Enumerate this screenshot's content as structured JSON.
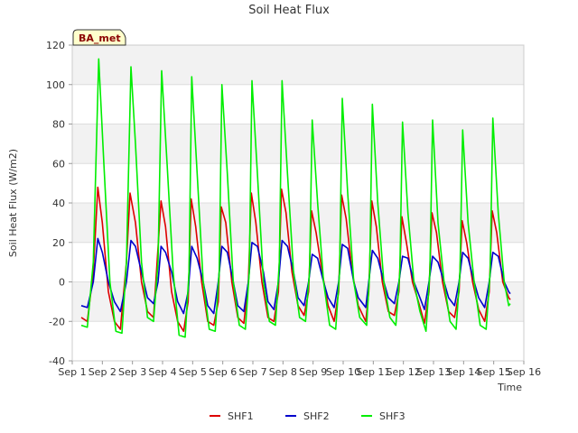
{
  "chart_data": {
    "type": "line",
    "title": "Soil Heat Flux",
    "xlabel": "Time",
    "ylabel": "Soil Heat Flux (W/m2)",
    "badge": "BA_met",
    "ylim": [
      -40,
      120
    ],
    "xlim": [
      1,
      16
    ],
    "y_ticks": [
      -40,
      -20,
      0,
      20,
      40,
      60,
      80,
      100,
      120
    ],
    "x_ticks": [
      {
        "x": 1,
        "label": "Sep 1"
      },
      {
        "x": 2,
        "label": "Sep 2"
      },
      {
        "x": 3,
        "label": "Sep 3"
      },
      {
        "x": 4,
        "label": "Sep 4"
      },
      {
        "x": 5,
        "label": "Sep 5"
      },
      {
        "x": 6,
        "label": "Sep 6"
      },
      {
        "x": 7,
        "label": "Sep 7"
      },
      {
        "x": 8,
        "label": "Sep 8"
      },
      {
        "x": 9,
        "label": "Sep 9"
      },
      {
        "x": 10,
        "label": "Sep 10"
      },
      {
        "x": 11,
        "label": "Sep 11"
      },
      {
        "x": 12,
        "label": "Sep 12"
      },
      {
        "x": 13,
        "label": "Sep 13"
      },
      {
        "x": 14,
        "label": "Sep 14"
      },
      {
        "x": 15,
        "label": "Sep 15"
      },
      {
        "x": 16,
        "label": "Sep 16"
      }
    ],
    "grid": "horizontal bands",
    "legend_position": "bottom-center",
    "series": [
      {
        "name": "SHF1",
        "color": "#dd0000",
        "points": [
          [
            1.3,
            -18
          ],
          [
            1.5,
            -20
          ],
          [
            1.7,
            5
          ],
          [
            1.85,
            48
          ],
          [
            2.0,
            30
          ],
          [
            2.2,
            -5
          ],
          [
            2.4,
            -20
          ],
          [
            2.6,
            -24
          ],
          [
            2.8,
            10
          ],
          [
            2.92,
            45
          ],
          [
            3.1,
            30
          ],
          [
            3.3,
            0
          ],
          [
            3.5,
            -15
          ],
          [
            3.7,
            -18
          ],
          [
            3.95,
            41
          ],
          [
            4.1,
            28
          ],
          [
            4.3,
            -5
          ],
          [
            4.5,
            -20
          ],
          [
            4.7,
            -25
          ],
          [
            4.85,
            -10
          ],
          [
            4.95,
            42
          ],
          [
            5.1,
            28
          ],
          [
            5.3,
            0
          ],
          [
            5.5,
            -20
          ],
          [
            5.7,
            -22
          ],
          [
            5.85,
            -10
          ],
          [
            5.95,
            38
          ],
          [
            6.1,
            30
          ],
          [
            6.3,
            0
          ],
          [
            6.5,
            -18
          ],
          [
            6.7,
            -21
          ],
          [
            6.85,
            0
          ],
          [
            6.95,
            45
          ],
          [
            7.1,
            30
          ],
          [
            7.3,
            0
          ],
          [
            7.5,
            -18
          ],
          [
            7.7,
            -20
          ],
          [
            7.85,
            -5
          ],
          [
            7.95,
            47
          ],
          [
            8.1,
            35
          ],
          [
            8.3,
            5
          ],
          [
            8.5,
            -12
          ],
          [
            8.7,
            -17
          ],
          [
            8.85,
            -5
          ],
          [
            8.95,
            36
          ],
          [
            9.1,
            25
          ],
          [
            9.3,
            5
          ],
          [
            9.5,
            -12
          ],
          [
            9.7,
            -20
          ],
          [
            9.85,
            -5
          ],
          [
            9.95,
            44
          ],
          [
            10.1,
            32
          ],
          [
            10.3,
            5
          ],
          [
            10.5,
            -12
          ],
          [
            10.75,
            -20
          ],
          [
            10.85,
            -5
          ],
          [
            10.95,
            41
          ],
          [
            11.1,
            28
          ],
          [
            11.3,
            0
          ],
          [
            11.5,
            -15
          ],
          [
            11.7,
            -17
          ],
          [
            11.85,
            -5
          ],
          [
            11.95,
            33
          ],
          [
            12.1,
            20
          ],
          [
            12.3,
            0
          ],
          [
            12.5,
            -10
          ],
          [
            12.7,
            -21
          ],
          [
            12.85,
            -5
          ],
          [
            12.95,
            35
          ],
          [
            13.1,
            25
          ],
          [
            13.3,
            0
          ],
          [
            13.5,
            -15
          ],
          [
            13.7,
            -18
          ],
          [
            13.85,
            -5
          ],
          [
            13.95,
            31
          ],
          [
            14.1,
            20
          ],
          [
            14.3,
            0
          ],
          [
            14.5,
            -14
          ],
          [
            14.7,
            -20
          ],
          [
            14.85,
            -5
          ],
          [
            14.95,
            36
          ],
          [
            15.1,
            25
          ],
          [
            15.3,
            0
          ],
          [
            15.5,
            -8
          ],
          [
            15.55,
            -9
          ]
        ]
      },
      {
        "name": "SHF2",
        "color": "#0000cc",
        "points": [
          [
            1.3,
            -12
          ],
          [
            1.5,
            -13
          ],
          [
            1.7,
            0
          ],
          [
            1.85,
            22
          ],
          [
            2.0,
            15
          ],
          [
            2.2,
            0
          ],
          [
            2.4,
            -10
          ],
          [
            2.6,
            -15
          ],
          [
            2.8,
            0
          ],
          [
            2.95,
            21
          ],
          [
            3.1,
            18
          ],
          [
            3.3,
            5
          ],
          [
            3.5,
            -8
          ],
          [
            3.7,
            -11
          ],
          [
            3.85,
            0
          ],
          [
            3.95,
            18
          ],
          [
            4.1,
            15
          ],
          [
            4.3,
            5
          ],
          [
            4.5,
            -10
          ],
          [
            4.7,
            -16
          ],
          [
            4.85,
            -5
          ],
          [
            4.97,
            18
          ],
          [
            5.15,
            12
          ],
          [
            5.35,
            0
          ],
          [
            5.5,
            -12
          ],
          [
            5.7,
            -16
          ],
          [
            5.85,
            0
          ],
          [
            5.97,
            18
          ],
          [
            6.15,
            15
          ],
          [
            6.35,
            0
          ],
          [
            6.5,
            -12
          ],
          [
            6.7,
            -15
          ],
          [
            6.85,
            0
          ],
          [
            6.97,
            20
          ],
          [
            7.15,
            18
          ],
          [
            7.35,
            5
          ],
          [
            7.5,
            -10
          ],
          [
            7.7,
            -14
          ],
          [
            7.85,
            0
          ],
          [
            7.97,
            21
          ],
          [
            8.15,
            18
          ],
          [
            8.35,
            5
          ],
          [
            8.5,
            -8
          ],
          [
            8.7,
            -12
          ],
          [
            8.85,
            0
          ],
          [
            8.97,
            14
          ],
          [
            9.15,
            12
          ],
          [
            9.35,
            0
          ],
          [
            9.5,
            -8
          ],
          [
            9.7,
            -13
          ],
          [
            9.85,
            0
          ],
          [
            9.97,
            19
          ],
          [
            10.15,
            17
          ],
          [
            10.35,
            0
          ],
          [
            10.5,
            -8
          ],
          [
            10.75,
            -13
          ],
          [
            10.85,
            0
          ],
          [
            10.97,
            16
          ],
          [
            11.15,
            12
          ],
          [
            11.35,
            0
          ],
          [
            11.5,
            -8
          ],
          [
            11.7,
            -11
          ],
          [
            11.85,
            0
          ],
          [
            11.97,
            13
          ],
          [
            12.15,
            12
          ],
          [
            12.35,
            0
          ],
          [
            12.5,
            -6
          ],
          [
            12.7,
            -14
          ],
          [
            12.85,
            0
          ],
          [
            12.97,
            13
          ],
          [
            13.15,
            10
          ],
          [
            13.35,
            0
          ],
          [
            13.5,
            -8
          ],
          [
            13.7,
            -12
          ],
          [
            13.85,
            0
          ],
          [
            13.97,
            15
          ],
          [
            14.15,
            12
          ],
          [
            14.35,
            0
          ],
          [
            14.5,
            -8
          ],
          [
            14.7,
            -13
          ],
          [
            14.85,
            0
          ],
          [
            14.97,
            15
          ],
          [
            15.15,
            13
          ],
          [
            15.35,
            0
          ],
          [
            15.5,
            -5
          ],
          [
            15.55,
            -6
          ]
        ]
      },
      {
        "name": "SHF3",
        "color": "#00ee00",
        "points": [
          [
            1.3,
            -22
          ],
          [
            1.5,
            -23
          ],
          [
            1.7,
            10
          ],
          [
            1.88,
            113
          ],
          [
            2.05,
            60
          ],
          [
            2.25,
            0
          ],
          [
            2.45,
            -25
          ],
          [
            2.65,
            -26
          ],
          [
            2.8,
            10
          ],
          [
            2.95,
            109
          ],
          [
            3.1,
            70
          ],
          [
            3.3,
            10
          ],
          [
            3.5,
            -18
          ],
          [
            3.7,
            -20
          ],
          [
            3.85,
            10
          ],
          [
            3.97,
            107
          ],
          [
            4.15,
            60
          ],
          [
            4.35,
            5
          ],
          [
            4.55,
            -27
          ],
          [
            4.75,
            -28
          ],
          [
            4.88,
            5
          ],
          [
            4.97,
            104
          ],
          [
            5.15,
            55
          ],
          [
            5.35,
            0
          ],
          [
            5.55,
            -24
          ],
          [
            5.75,
            -25
          ],
          [
            5.88,
            5
          ],
          [
            5.97,
            100
          ],
          [
            6.15,
            55
          ],
          [
            6.35,
            0
          ],
          [
            6.55,
            -22
          ],
          [
            6.75,
            -24
          ],
          [
            6.88,
            5
          ],
          [
            6.97,
            102
          ],
          [
            7.15,
            55
          ],
          [
            7.35,
            0
          ],
          [
            7.55,
            -20
          ],
          [
            7.75,
            -22
          ],
          [
            7.88,
            10
          ],
          [
            7.97,
            102
          ],
          [
            8.15,
            55
          ],
          [
            8.35,
            5
          ],
          [
            8.55,
            -18
          ],
          [
            8.75,
            -20
          ],
          [
            8.88,
            5
          ],
          [
            8.97,
            82
          ],
          [
            9.15,
            40
          ],
          [
            9.35,
            0
          ],
          [
            9.55,
            -22
          ],
          [
            9.75,
            -24
          ],
          [
            9.88,
            5
          ],
          [
            9.97,
            93
          ],
          [
            10.15,
            45
          ],
          [
            10.35,
            0
          ],
          [
            10.55,
            -18
          ],
          [
            10.78,
            -22
          ],
          [
            10.88,
            5
          ],
          [
            10.97,
            90
          ],
          [
            11.15,
            40
          ],
          [
            11.35,
            0
          ],
          [
            11.55,
            -18
          ],
          [
            11.75,
            -22
          ],
          [
            11.88,
            5
          ],
          [
            11.97,
            81
          ],
          [
            12.15,
            35
          ],
          [
            12.35,
            0
          ],
          [
            12.55,
            -15
          ],
          [
            12.75,
            -25
          ],
          [
            12.88,
            5
          ],
          [
            12.97,
            82
          ],
          [
            13.15,
            30
          ],
          [
            13.35,
            0
          ],
          [
            13.55,
            -20
          ],
          [
            13.75,
            -24
          ],
          [
            13.88,
            5
          ],
          [
            13.97,
            77
          ],
          [
            14.15,
            30
          ],
          [
            14.35,
            0
          ],
          [
            14.55,
            -22
          ],
          [
            14.75,
            -24
          ],
          [
            14.88,
            5
          ],
          [
            14.97,
            83
          ],
          [
            15.15,
            35
          ],
          [
            15.35,
            0
          ],
          [
            15.5,
            -12
          ],
          [
            15.55,
            -11
          ]
        ]
      }
    ]
  }
}
